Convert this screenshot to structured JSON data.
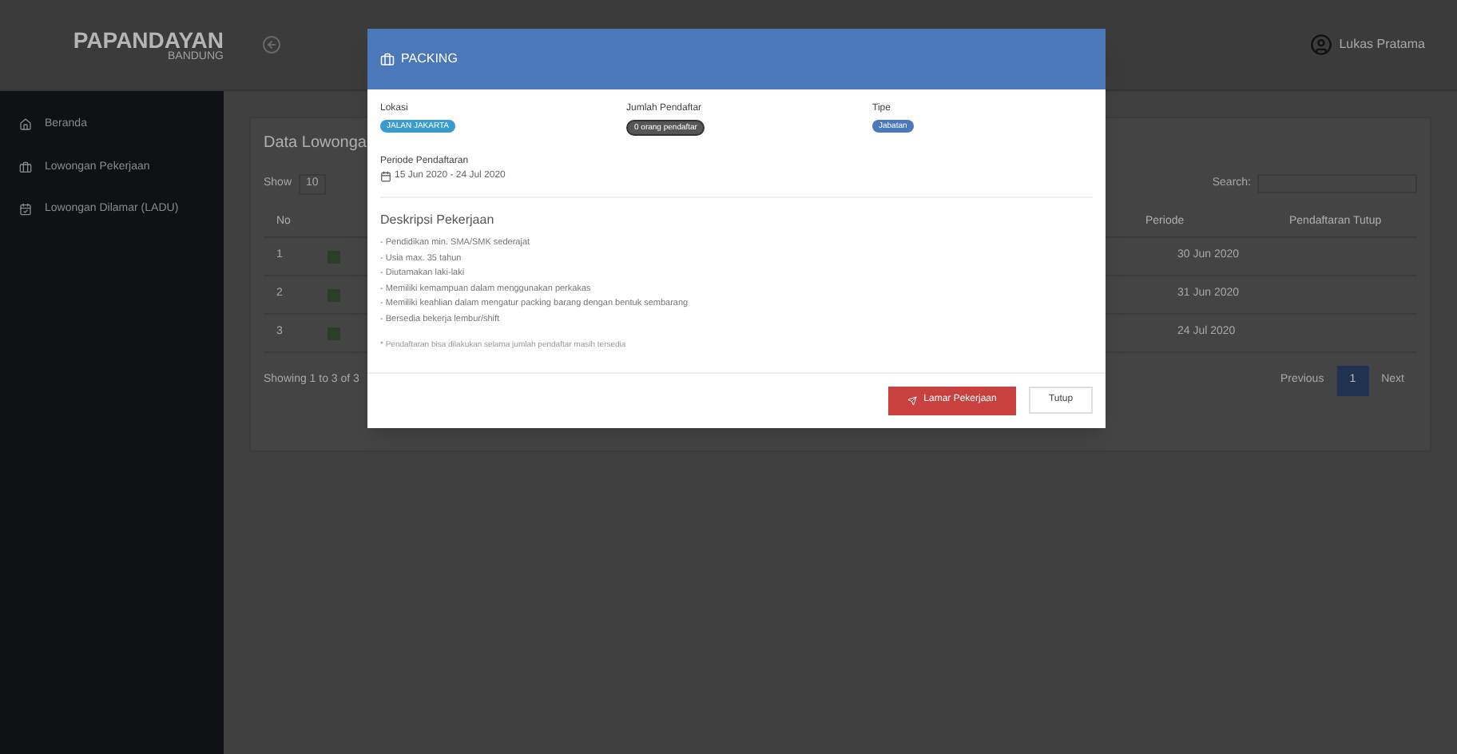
{
  "header": {
    "logo": "PAPANDAYAN",
    "logo_sub": "BANDUNG",
    "user": "Lukas Pratama"
  },
  "sidebar": {
    "items": [
      {
        "label": "Beranda",
        "selected": false
      },
      {
        "label": "Lowongan Pekerjaan",
        "selected": false
      },
      {
        "label": "Lowongan Dilamar (LADU)",
        "selected": false
      }
    ]
  },
  "content": {
    "title": "Data Lowonga",
    "show_label": "Show",
    "show_value": "10",
    "search_label": "Search:",
    "table": {
      "columns": [
        "No",
        "Periode",
        "Pendaftaran Tutup"
      ],
      "rows": [
        {
          "no": "1",
          "date": "30 Jun 2020"
        },
        {
          "no": "2",
          "date": "31 Jun 2020"
        },
        {
          "no": "3",
          "date": "24 Jul 2020"
        }
      ]
    },
    "footer": "Showing 1 to 3 of 3",
    "pagination": [
      {
        "label": "Previous",
        "selected": false
      },
      {
        "label": "1",
        "selected": true
      },
      {
        "label": "Next",
        "selected": false
      }
    ]
  },
  "modal": {
    "title": "PACKING",
    "fields": [
      {
        "label": "Lokasi",
        "value": "JALAN JAKARTA",
        "kind": "info"
      },
      {
        "label": "Jumlah Pendaftar",
        "value": "0 orang pendaftar",
        "kind": "pill"
      },
      {
        "label": "Tipe",
        "value": "Jabatan",
        "kind": "primary"
      }
    ],
    "period_label": "Periode Pendaftaran",
    "period": "15 Jun 2020 - 24 Jul 2020",
    "description_title": "Deskripsi Pekerjaan",
    "description": [
      "- Pendidikan min. SMA/SMK sederajat",
      "- Usia max. 35 tahun",
      "- Diutamakan laki-laki",
      "- Memiliki kemampuan dalam menggunakan perkakas",
      "- Memiliki keahlian dalam mengatur packing barang dengan bentuk sembarang",
      "- Bersedia bekerja lembur/shift"
    ],
    "note": "* Pendaftaran bisa dilakukan selama jumlah pendaftar masih tersedia",
    "apply_button": "Lamar Pekerjaan",
    "close_button": "Tutup"
  }
}
